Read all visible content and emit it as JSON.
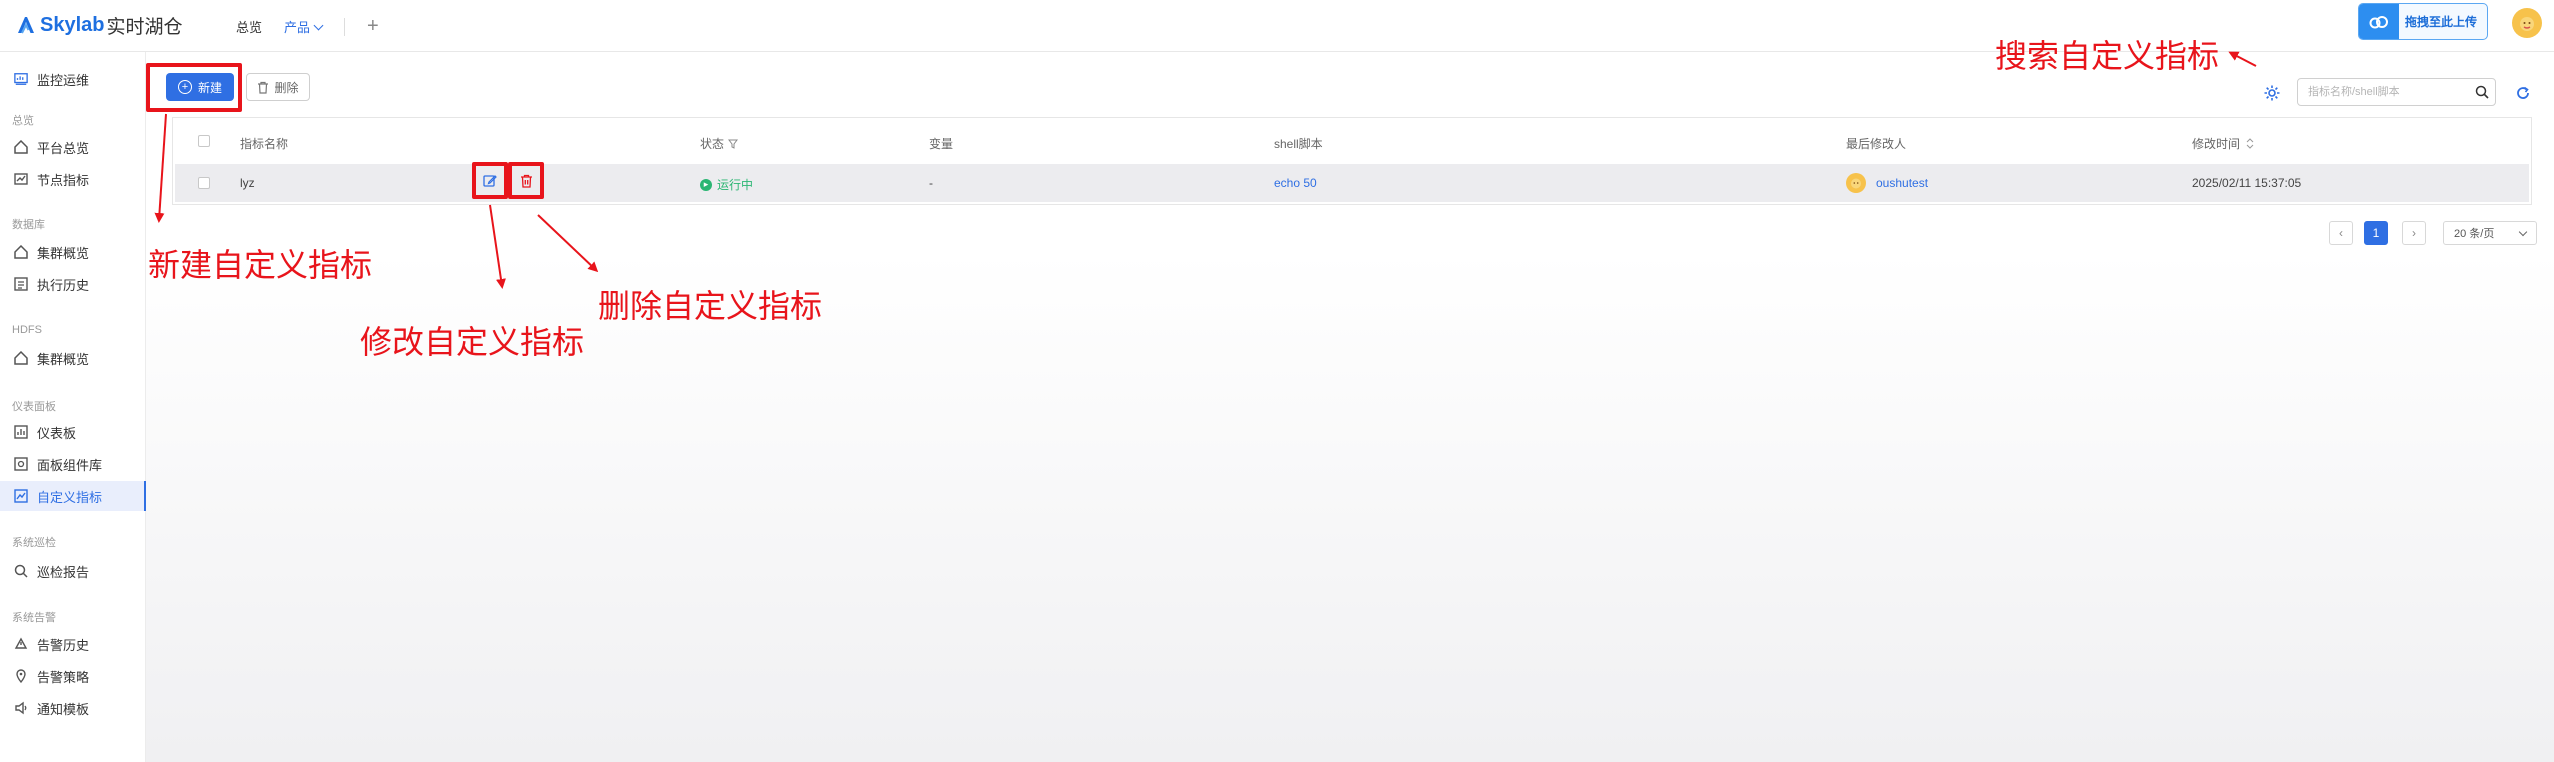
{
  "app": {
    "brand": "Skylab",
    "brand_cn": "实时湖仓",
    "nav": [
      "总览",
      "产品"
    ],
    "upload_label": "拖拽至此上传"
  },
  "sidebar": {
    "top_item": "监控运维",
    "groups": [
      {
        "title": "总览",
        "items": [
          "平台总览",
          "节点指标"
        ]
      },
      {
        "title": "数据库",
        "items": [
          "集群概览",
          "执行历史"
        ]
      },
      {
        "title": "HDFS",
        "items": [
          "集群概览"
        ]
      },
      {
        "title": "仪表面板",
        "items": [
          "仪表板",
          "面板组件库",
          "自定义指标"
        ]
      },
      {
        "title": "系统巡检",
        "items": [
          "巡检报告"
        ]
      },
      {
        "title": "系统告警",
        "items": [
          "告警历史",
          "告警策略",
          "通知模板"
        ]
      }
    ],
    "active_item": "自定义指标"
  },
  "toolbar": {
    "new_label": "新建",
    "delete_label": "删除",
    "search_placeholder": "指标名称/shell脚本"
  },
  "table": {
    "columns": [
      "指标名称",
      "状态",
      "变量",
      "shell脚本",
      "最后修改人",
      "修改时间"
    ],
    "rows": [
      {
        "name": "lyz",
        "status": "运行中",
        "variable": "-",
        "script": "echo 50",
        "modifier": "oushutest",
        "modified_at": "2025/02/11 15:37:05"
      }
    ]
  },
  "pagination": {
    "current_page": "1",
    "page_size": "20 条/页"
  },
  "annotations": {
    "new": "新建自定义指标",
    "edit": "修改自定义指标",
    "delete": "删除自定义指标",
    "search": "搜索自定义指标"
  },
  "colors": {
    "accent": "#2f6fe3",
    "annotation": "#e8141b",
    "running": "#2bb673"
  }
}
